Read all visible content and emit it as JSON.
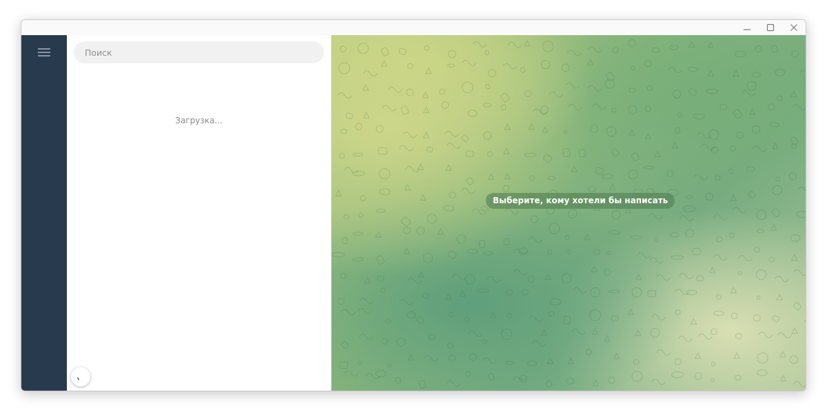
{
  "window": {
    "controls": [
      "minimize-icon",
      "maximize-icon",
      "close-icon"
    ]
  },
  "sidebar": {
    "menu_icon": "hamburger-menu-icon",
    "color": "#283a4e"
  },
  "chat_list": {
    "search": {
      "placeholder": "Поиск",
      "value": ""
    },
    "loading_text": "Загрузка..."
  },
  "chat_area": {
    "empty_placeholder": "Выберите, кому хотели бы написать"
  },
  "colors": {
    "sidebar": "#283a4e",
    "search_background": "#f1f1f1",
    "placeholder_bubble": "#538052",
    "wallpaper_yellow": "#cdd68a",
    "wallpaper_green": "#5f9f7c",
    "wallpaper_pale": "#d9dfb3"
  }
}
